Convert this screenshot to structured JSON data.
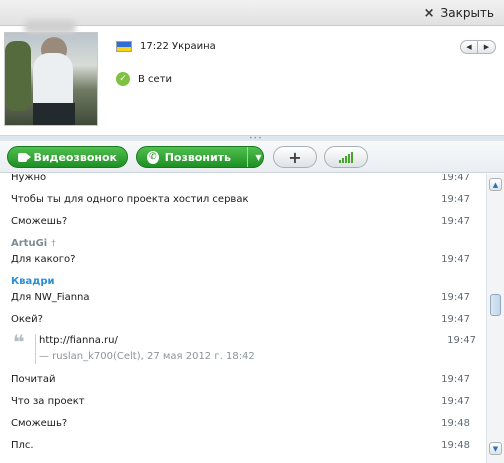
{
  "topbar": {
    "close_label": "Закрыть",
    "close_icon": "×"
  },
  "profile": {
    "local_time": "17:22 Украина",
    "status": "В сети",
    "flag_colors": [
      "#2f6fd3",
      "#f6d21a"
    ],
    "status_color": "#7fc241"
  },
  "actions": {
    "video_label": "Видеозвонок",
    "call_label": "Позвонить",
    "add_label": "+",
    "brand_color": "#1e8f23"
  },
  "chat": {
    "messages": [
      {
        "text": "Нужно",
        "time": "19:47"
      },
      {
        "text": "Чтобы ты для одного проекта хостил сервак",
        "time": "19:47"
      },
      {
        "text": "Сможешь?",
        "time": "19:47"
      },
      {
        "sender": "ArtuGi",
        "pin": "†"
      },
      {
        "text": "Для какого?",
        "time": "19:47"
      },
      {
        "sender": "Квадри"
      },
      {
        "text": "Для NW_Fianna",
        "time": "19:47"
      },
      {
        "text": "Окей?",
        "time": "19:47"
      },
      {
        "text": "Почитай",
        "time": "19:47"
      },
      {
        "text": "Что за проект",
        "time": "19:47"
      },
      {
        "text": "Сможешь?",
        "time": "19:48"
      },
      {
        "text": "Плс.",
        "time": "19:48"
      }
    ],
    "quote": {
      "link": "http://fianna.ru/",
      "source": "— ruslan_k700(Celt), 27 мая 2012 г. 18:42",
      "time": "19:47"
    }
  }
}
